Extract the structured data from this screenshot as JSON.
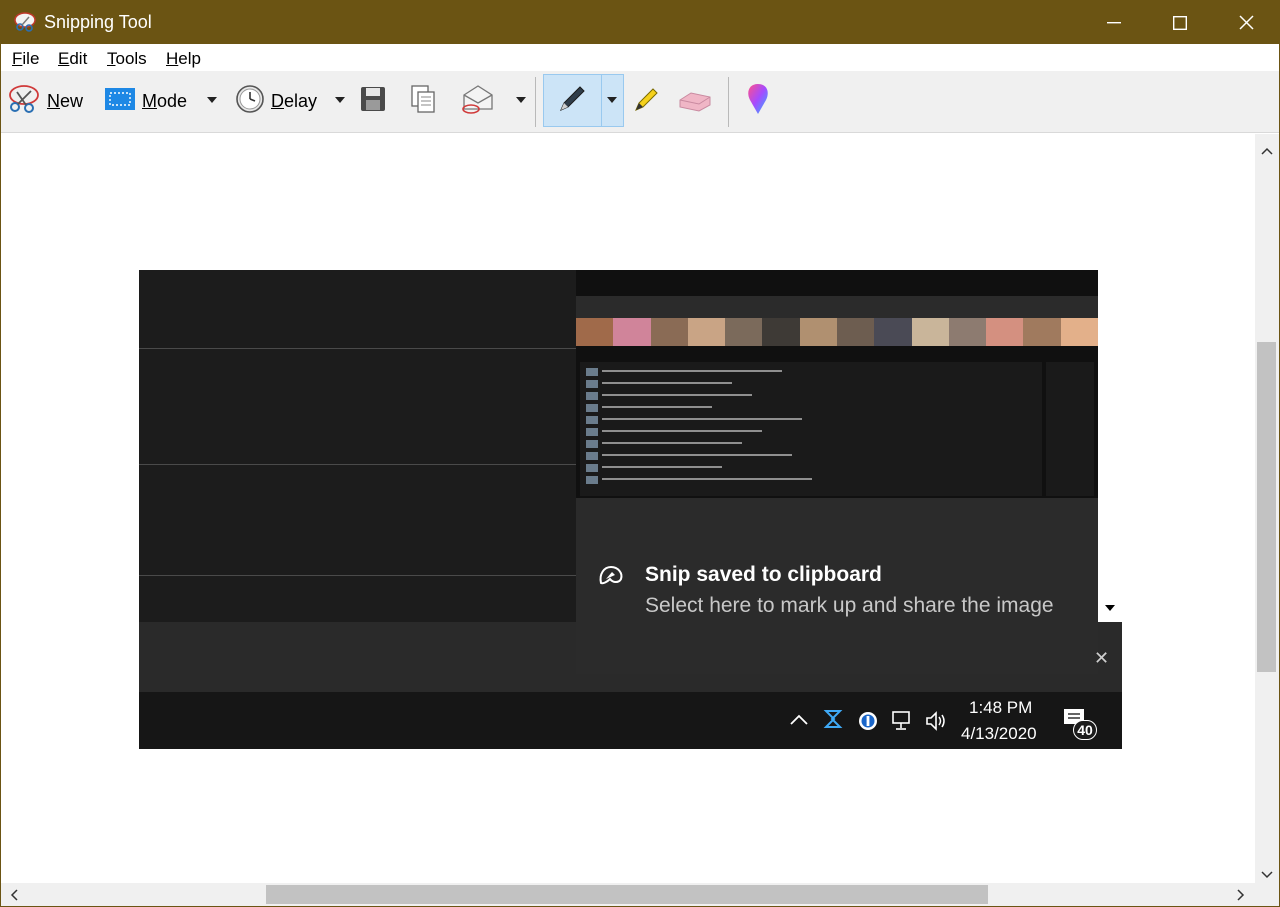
{
  "window": {
    "title": "Snipping Tool",
    "titlebar_color": "#6b5413"
  },
  "menu": {
    "file": {
      "key": "F",
      "rest": "ile"
    },
    "edit": {
      "key": "E",
      "rest": "dit"
    },
    "tools": {
      "key": "T",
      "rest": "ools"
    },
    "help": {
      "key": "H",
      "rest": "elp"
    }
  },
  "toolbar": {
    "new": {
      "key": "N",
      "rest": "ew",
      "icon": "scissors-icon"
    },
    "mode": {
      "key": "M",
      "rest": "ode",
      "icon": "rectangle-snip-icon"
    },
    "delay": {
      "key": "D",
      "rest": "elay",
      "icon": "clock-icon"
    },
    "save_icon": "floppy-disk-icon",
    "copy_icon": "copy-icon",
    "send_icon": "envelope-icon",
    "pen_icon": "pen-icon",
    "highlighter_icon": "highlighter-icon",
    "eraser_icon": "eraser-icon",
    "paint3d_icon": "paint-3d-icon",
    "active_tool": "pen"
  },
  "snip": {
    "toast": {
      "title": "Snip saved to clipboard",
      "body": "Select here to mark up and share the image"
    },
    "taskbar": {
      "time": "1:48 PM",
      "date": "4/13/2020",
      "notification_count": "40"
    }
  },
  "colors": {
    "accent": "#cce4f7",
    "toolbar_bg": "#f0f0f0"
  }
}
